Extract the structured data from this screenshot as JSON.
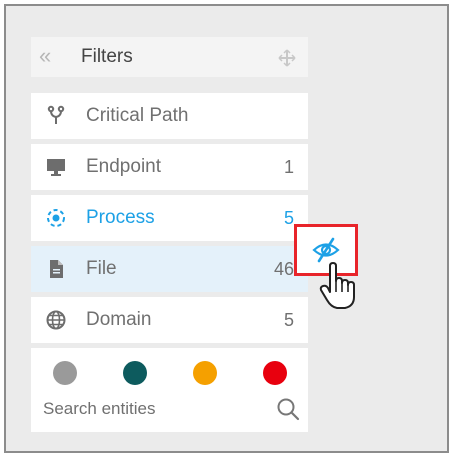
{
  "panel": {
    "title": "Filters",
    "collapse_icon": "double-chevron-left-icon",
    "move_icon": "move-icon"
  },
  "filters": [
    {
      "label": "Critical Path",
      "count": "",
      "icon": "fork-icon"
    },
    {
      "label": "Endpoint",
      "count": "1",
      "icon": "monitor-icon"
    },
    {
      "label": "Process",
      "count": "5",
      "icon": "process-icon",
      "active": true
    },
    {
      "label": "File",
      "count": "46",
      "icon": "file-icon",
      "hovered": true
    },
    {
      "label": "Domain",
      "count": "5",
      "icon": "globe-icon"
    }
  ],
  "color_filters": [
    "#9a9a9a",
    "#0d5b5e",
    "#f5a000",
    "#e8000e"
  ],
  "search": {
    "placeholder": "Search entities"
  },
  "colors": {
    "accent": "#1da1e6",
    "highlight_border": "#e8242a",
    "hover_row": "#e4f1fa"
  }
}
